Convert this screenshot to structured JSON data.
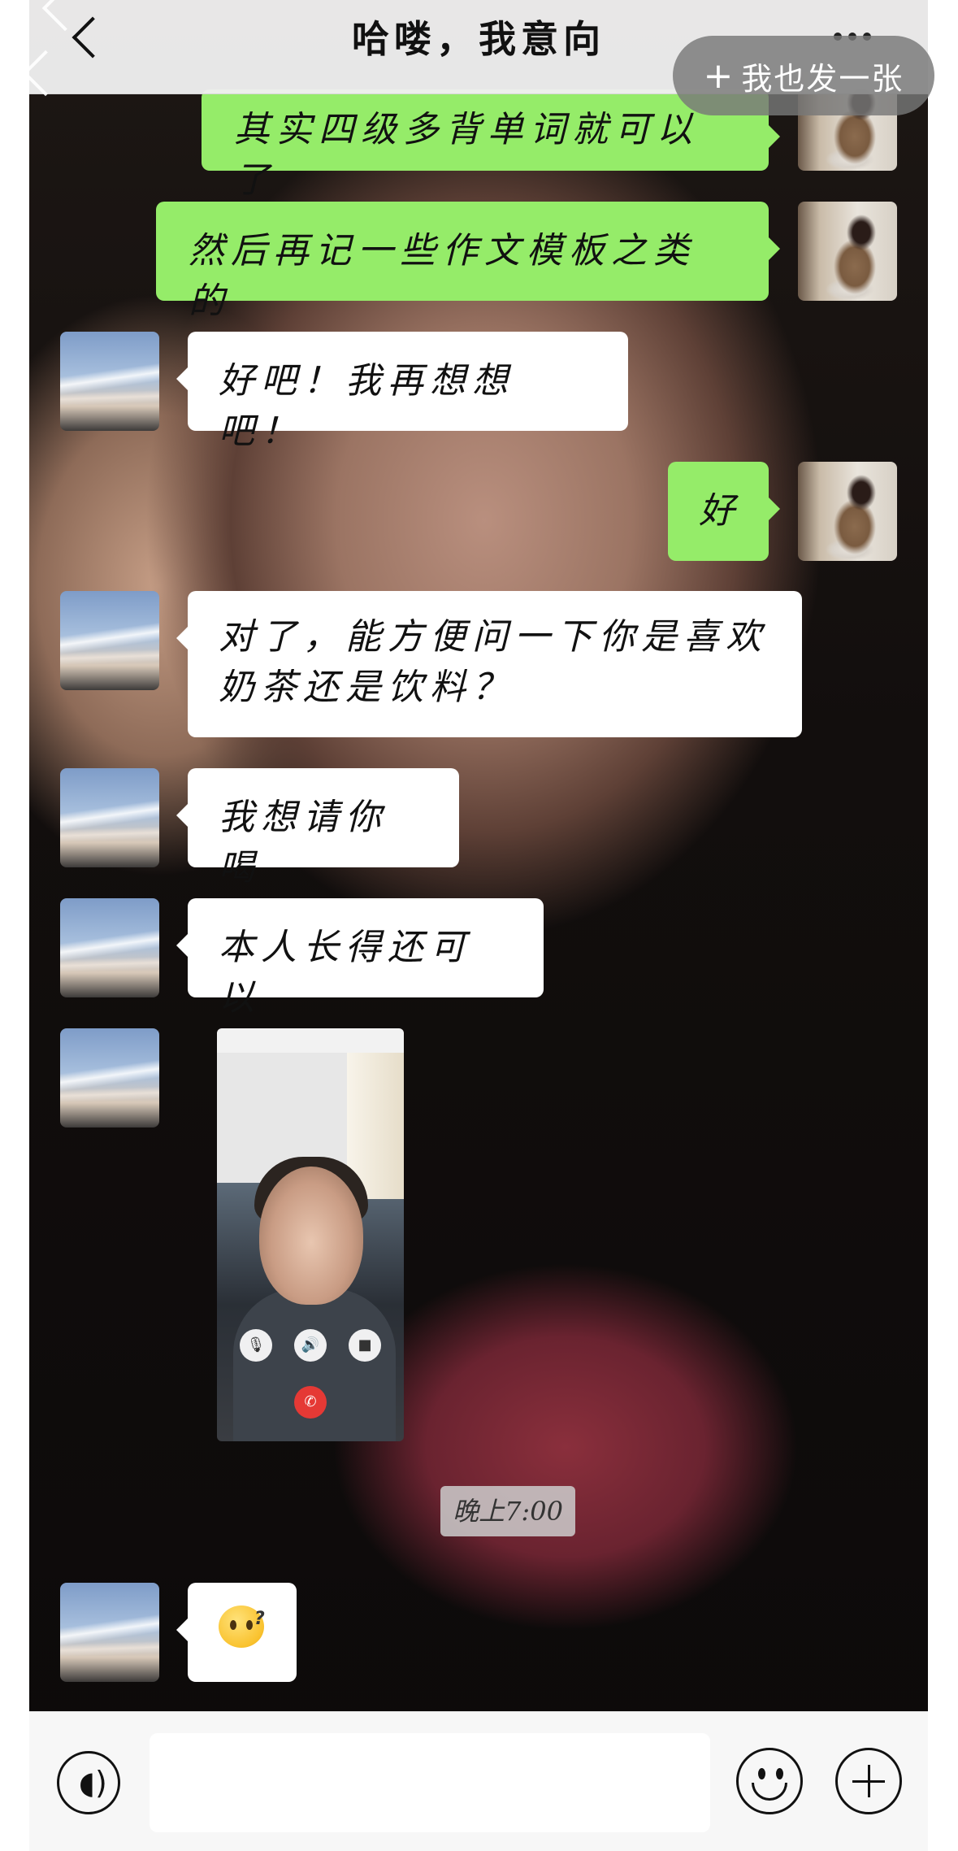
{
  "header": {
    "title": "哈喽，我意向",
    "post_button_label": "我也发一张"
  },
  "messages": [
    {
      "side": "out",
      "text": "其实四级多背单词就可以了"
    },
    {
      "side": "out",
      "text": "然后再记一些作文模板之类的"
    },
    {
      "side": "in",
      "text": "好吧！我再想想吧！"
    },
    {
      "side": "out",
      "text": "好"
    },
    {
      "side": "in",
      "lines": [
        "对了，能方便问一下你是喜欢",
        "奶茶还是饮料？"
      ]
    },
    {
      "side": "in",
      "text": "我想请你喝"
    },
    {
      "side": "in",
      "text": "本人长得还可以"
    },
    {
      "side": "in",
      "type": "image",
      "image_desc": "video-call-screenshot"
    },
    {
      "type": "time",
      "text": "晚上7:00"
    },
    {
      "side": "in",
      "type": "sticker",
      "sticker_desc": "confused-emoji"
    }
  ],
  "input": {
    "value": "",
    "placeholder": ""
  },
  "icons": {
    "back": "back-chevron-icon",
    "more": "more-dots-icon",
    "voice": "voice-icon",
    "emoji": "emoji-icon",
    "plus": "plus-icon"
  },
  "colors": {
    "outgoing_bubble": "#95ec69",
    "incoming_bubble": "#ffffff",
    "header_bg": "#eeeeee"
  }
}
